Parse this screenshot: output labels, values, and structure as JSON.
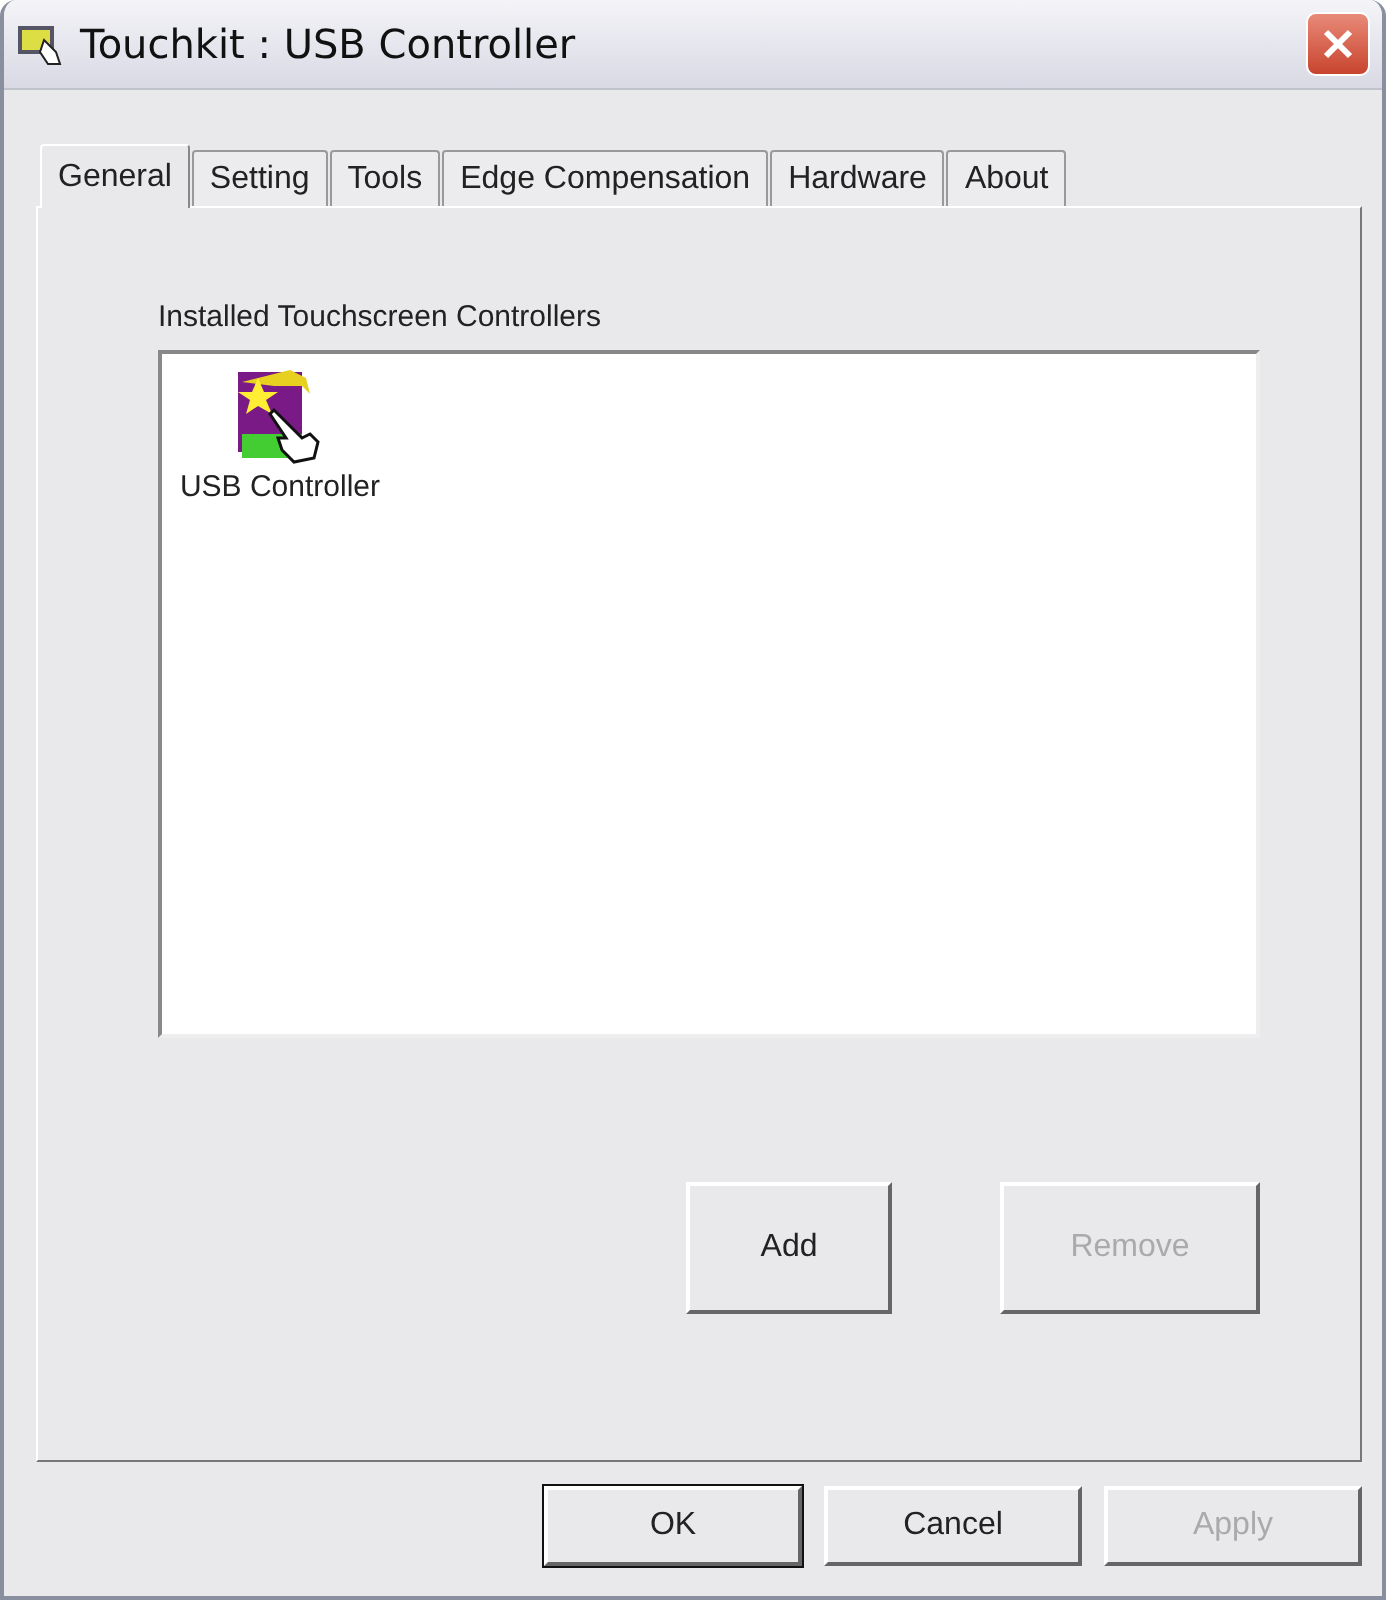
{
  "window": {
    "title": "Touchkit : USB Controller"
  },
  "tabs": [
    {
      "label": "General",
      "selected": true
    },
    {
      "label": "Setting",
      "selected": false
    },
    {
      "label": "Tools",
      "selected": false
    },
    {
      "label": "Edge Compensation",
      "selected": false
    },
    {
      "label": "Hardware",
      "selected": false
    },
    {
      "label": "About",
      "selected": false
    }
  ],
  "controllers": {
    "label": "Installed Touchscreen Controllers",
    "items": [
      {
        "name": "USB Controller",
        "selected": false
      }
    ]
  },
  "panel_buttons": [
    {
      "label": "Add",
      "disabled": false
    },
    {
      "label": "Remove",
      "disabled": true
    }
  ],
  "dialog_buttons": [
    {
      "label": "OK",
      "disabled": false,
      "default": true
    },
    {
      "label": "Cancel",
      "disabled": false,
      "default": false
    },
    {
      "label": "Apply",
      "disabled": true,
      "default": false
    }
  ]
}
